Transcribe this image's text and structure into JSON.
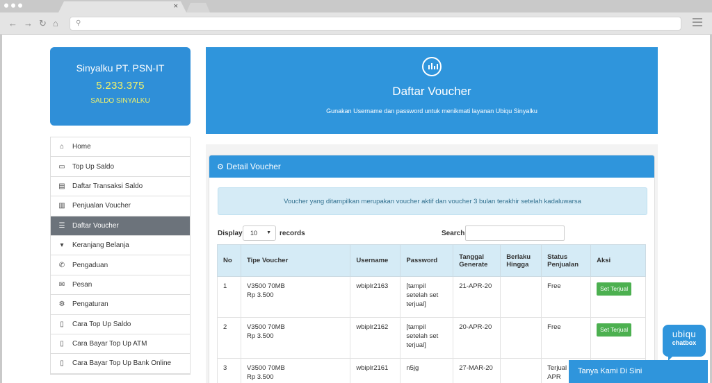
{
  "browser": {
    "url": "",
    "tab_close": "×"
  },
  "balance_card": {
    "name": "Sinyalku PT. PSN-IT",
    "amount": "5.233.375",
    "label": "SALDO SINYALKU"
  },
  "sidebar": {
    "items": [
      {
        "label": "Home",
        "icon": "home-icon",
        "glyph": "⌂"
      },
      {
        "label": "Top Up Saldo",
        "icon": "credit-card-icon",
        "glyph": "▭"
      },
      {
        "label": "Daftar Transaksi Saldo",
        "icon": "document-icon",
        "glyph": "▤"
      },
      {
        "label": "Penjualan Voucher",
        "icon": "bar-chart-icon",
        "glyph": "▥"
      },
      {
        "label": "Daftar Voucher",
        "icon": "list-icon",
        "glyph": "☰",
        "active": true
      },
      {
        "label": "Keranjang Belanja",
        "icon": "cart-icon",
        "glyph": "🛒"
      },
      {
        "label": "Pengaduan",
        "icon": "phone-icon",
        "glyph": "✆"
      },
      {
        "label": "Pesan",
        "icon": "envelope-icon",
        "glyph": "✉"
      },
      {
        "label": "Pengaturan",
        "icon": "gear-icon",
        "glyph": "⚙"
      },
      {
        "label": "Cara Top Up Saldo",
        "icon": "file-icon",
        "glyph": "▯"
      },
      {
        "label": "Cara Bayar Top Up ATM",
        "icon": "file-icon",
        "glyph": "▯"
      },
      {
        "label": "Cara Bayar Top Up Bank Online",
        "icon": "file-icon",
        "glyph": "▯"
      }
    ]
  },
  "banner": {
    "icon": "bar-chart-icon",
    "title": "Daftar Voucher",
    "subtitle": "Gunakan Username dan password untuk menikmati layanan Ubiqu Sinyalku"
  },
  "panel": {
    "title": "Detail Voucher",
    "info": "Voucher yang ditampilkan merupakan voucher aktif dan voucher 3 bulan terakhir setelah kadaluwarsa",
    "display_label": "Display",
    "records_value": "10",
    "records_label": "records",
    "search_label": "Search:",
    "search_value": ""
  },
  "table": {
    "headers": [
      "No",
      "Tipe Voucher",
      "Username",
      "Password",
      "Tanggal Generate",
      "Berlaku Hingga",
      "Status Penjualan",
      "Aksi"
    ],
    "rows": [
      {
        "no": "1",
        "tipe": "V3500 70MB",
        "harga": "Rp 3.500",
        "username": "wbiplr2163",
        "password": "[tampil setelah set terjual]",
        "tanggal": "21-APR-20",
        "berlaku": "",
        "status": "Free",
        "aksi": "Set Terjual"
      },
      {
        "no": "2",
        "tipe": "V3500 70MB",
        "harga": "Rp 3.500",
        "username": "wbiplr2162",
        "password": "[tampil setelah set terjual]",
        "tanggal": "20-APR-20",
        "berlaku": "",
        "status": "Free",
        "aksi": "Set Terjual"
      },
      {
        "no": "3",
        "tipe": "V3500 70MB",
        "harga": "Rp 3.500",
        "username": "wbiplr2161",
        "password": "n5jg",
        "tanggal": "27-MAR-20",
        "berlaku": "",
        "status": "Terjual 20-APR",
        "aksi": ""
      }
    ]
  },
  "chat": {
    "brand_top": "ubiqu",
    "brand_bottom": "chatbox",
    "bar_label": "Tanya Kami Di Sini"
  },
  "colors": {
    "primary": "#2f95dc",
    "active_menu": "#6c737b",
    "success": "#4cb050",
    "balance_text": "#f3f36a"
  }
}
